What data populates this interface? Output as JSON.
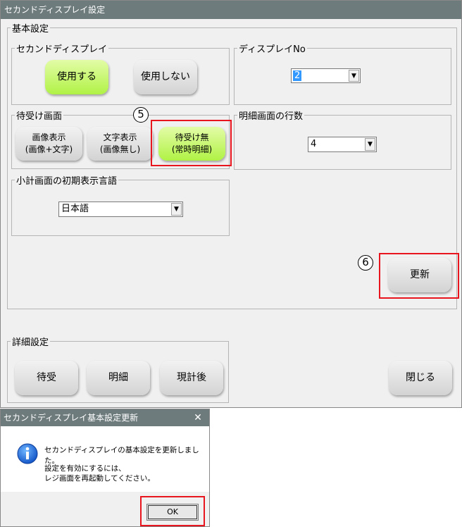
{
  "window": {
    "title": "セカンドディスプレイ設定"
  },
  "basic": {
    "group_label": "基本設定",
    "second_display": {
      "label": "セカンドディスプレイ",
      "use_label": "使用する",
      "no_use_label": "使用しない"
    },
    "display_no": {
      "label": "ディスプレイNo",
      "value": "2"
    },
    "standby": {
      "label": "待受け画面",
      "image_line1": "画像表示",
      "image_line2": "(画像+文字)",
      "text_line1": "文字表示",
      "text_line2": "(画像無し)",
      "none_line1": "待受け無",
      "none_line2": "(常時明細)"
    },
    "detail_rows": {
      "label": "明細画面の行数",
      "value": "4"
    },
    "subtotal_lang": {
      "label": "小計画面の初期表示言語",
      "value": "日本語"
    },
    "update_label": "更新"
  },
  "detail": {
    "group_label": "詳細設定",
    "standby_label": "待受",
    "meisai_label": "明細",
    "after_total_label": "現計後"
  },
  "close_label": "閉じる",
  "annotations": {
    "step5": "5",
    "step6": "6"
  },
  "dialog": {
    "title": "セカンドディスプレイ基本設定更新",
    "icon": "info-icon",
    "message1": "セカンドディスプレイの基本設定を更新しました。",
    "message2": "設定を有効にするには、",
    "message3": "レジ画面を再起動してください。",
    "ok_label": "OK"
  },
  "colors": {
    "titlebar": "#6e7b7c",
    "green_button": "#b0f245",
    "highlight_red": "#e8141e",
    "selection_blue": "#3399ff"
  }
}
